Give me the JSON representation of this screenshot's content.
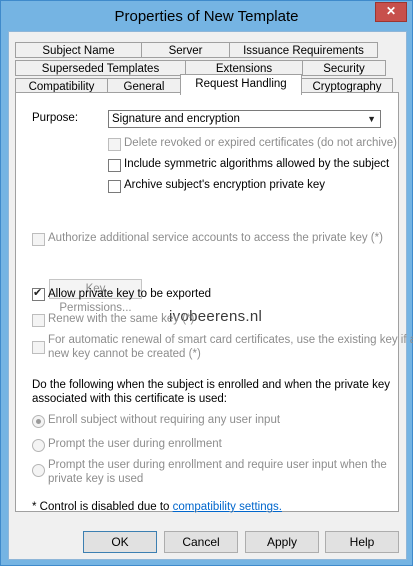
{
  "window": {
    "title": "Properties of New Template",
    "close_glyph": "✕"
  },
  "tabs": {
    "row1": [
      "Subject Name",
      "Server",
      "Issuance Requirements"
    ],
    "row2": [
      "Superseded Templates",
      "Extensions",
      "Security"
    ],
    "row3": [
      "Compatibility",
      "General",
      "Request Handling",
      "Cryptography"
    ],
    "active": "Request Handling"
  },
  "purpose": {
    "label": "Purpose:",
    "value": "Signature and encryption"
  },
  "options": {
    "delete_revoked": {
      "label": "Delete revoked or expired certificates (do not archive)",
      "checked": false,
      "enabled": false
    },
    "symmetric": {
      "label": "Include symmetric algorithms allowed by the subject",
      "checked": false,
      "enabled": true
    },
    "archive": {
      "label": "Archive subject's encryption private key",
      "checked": false,
      "enabled": true
    },
    "authorize": {
      "label": "Authorize additional service accounts to access the private key (*)",
      "checked": false,
      "enabled": false
    },
    "key_permissions": "Key Permissions...",
    "allow_export": {
      "label": "Allow private key to be exported",
      "checked": true,
      "enabled": true
    },
    "renew_same_key": {
      "label": "Renew with the same key (*)",
      "checked": false,
      "enabled": false
    },
    "smart_card": {
      "line1": "For automatic renewal of smart card certificates, use the existing key if a",
      "line2": "new key cannot be created (*)",
      "checked": false,
      "enabled": false
    }
  },
  "enroll": {
    "question_line1": "Do the following when the subject is enrolled and when the private key",
    "question_line2": "associated with this certificate is used:",
    "options": [
      {
        "label": "Enroll subject without requiring any user input",
        "selected": true
      },
      {
        "label": "Prompt the user during enrollment",
        "selected": false
      },
      {
        "line1": "Prompt the user during enrollment and require user input when the",
        "line2": "private key is used",
        "selected": false
      }
    ]
  },
  "footnote": {
    "text": "* Control is disabled due to ",
    "link": "compatibility settings."
  },
  "watermark": "ivobeerens.nl",
  "buttons": {
    "ok": "OK",
    "cancel": "Cancel",
    "apply": "Apply",
    "help": "Help"
  }
}
